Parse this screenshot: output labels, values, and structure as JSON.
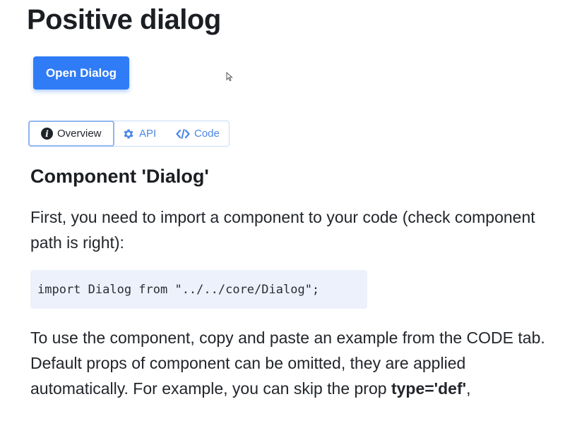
{
  "page": {
    "title": "Positive dialog"
  },
  "actions": {
    "open_dialog_label": "Open Dialog"
  },
  "tabs": [
    {
      "label": "Overview",
      "icon": "info-icon",
      "active": true
    },
    {
      "label": "API",
      "icon": "gear-icon",
      "active": false
    },
    {
      "label": "Code",
      "icon": "code-icon",
      "active": false
    }
  ],
  "content": {
    "heading": "Component 'Dialog'",
    "intro": "First, you need to import a component to your code (check component path is right):",
    "import_code": "import Dialog from \"../../core/Dialog\";",
    "usage": "To use the component, copy and paste an example from the CODE tab.",
    "defaults_prefix": "Default props of component can be omitted, they are applied automatically. For example, you can skip the prop ",
    "defaults_prop": "type='def'",
    "defaults_suffix": ","
  },
  "colors": {
    "accent": "#2f7cf6",
    "tab_text": "#4a86e8",
    "code_bg": "#edf1fb"
  }
}
